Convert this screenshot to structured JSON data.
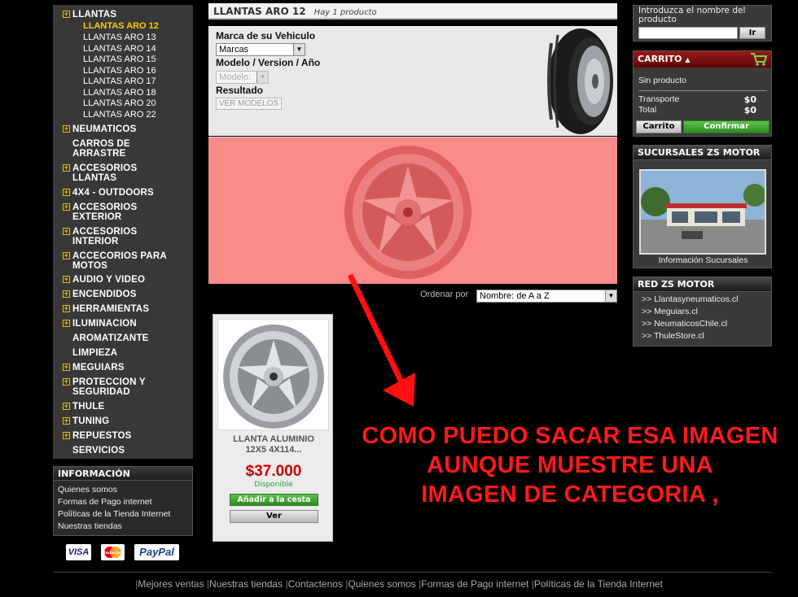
{
  "sidebar": {
    "categories": [
      {
        "label": "LLANTAS",
        "expandable": true
      },
      {
        "label": "NEUMATICOS",
        "expandable": true
      },
      {
        "label": "CARROS DE ARRASTRE",
        "expandable": false
      },
      {
        "label": "ACCESORIOS LLANTAS",
        "expandable": true
      },
      {
        "label": "4X4 - OUTDOORS",
        "expandable": true
      },
      {
        "label": "ACCESORIOS EXTERIOR",
        "expandable": true
      },
      {
        "label": "ACCESORIOS INTERIOR",
        "expandable": true
      },
      {
        "label": "ACCECORIOS PARA MOTOS",
        "expandable": true
      },
      {
        "label": "AUDIO Y VIDEO",
        "expandable": true
      },
      {
        "label": "ENCENDIDOS",
        "expandable": true
      },
      {
        "label": "HERRAMIENTAS",
        "expandable": true
      },
      {
        "label": "ILUMINACION",
        "expandable": true
      },
      {
        "label": "AROMATIZANTE",
        "expandable": false
      },
      {
        "label": "LIMPIEZA",
        "expandable": false
      },
      {
        "label": "MEGUIARS",
        "expandable": true
      },
      {
        "label": "PROTECCION Y SEGURIDAD",
        "expandable": true
      },
      {
        "label": "THULE",
        "expandable": true
      },
      {
        "label": "TUNING",
        "expandable": true
      },
      {
        "label": "REPUESTOS",
        "expandable": true
      },
      {
        "label": "SERVICIOS",
        "expandable": false
      }
    ],
    "subcategories": [
      "LLANTAS ARO 12",
      "LLANTAS ARO 13",
      "LLANTAS ARO 14",
      "LLANTAS ARO 15",
      "LLANTAS ARO 16",
      "LLANTAS ARO 17",
      "LLANTAS ARO 18",
      "LLANTAS ARO 20",
      "LLANTAS ARO 22"
    ],
    "active_sub": "LLANTAS ARO 12",
    "plus_glyph": "+"
  },
  "info": {
    "title": "INFORMACIÓN",
    "links": [
      "Quienes somos",
      "Formas de Pago internet",
      "Políticas de la Tienda Internet",
      "Nuestras tiendas"
    ]
  },
  "payment": {
    "visa": "VISA",
    "mastercard": "MasterCard",
    "paypal": "PayPal"
  },
  "center": {
    "title": "LLANTAS ARO 12",
    "count": "Hay 1 producto",
    "search": {
      "brand_label": "Marca de su Vehiculo",
      "brand_value": "Marcas",
      "model_label": "Modelo / Version / Año",
      "model_value": "Modelo:",
      "result_label": "Resultado",
      "button": "VER MODELOS"
    },
    "sort_label": "Ordenar por",
    "sort_value": "Nombre: de A a Z"
  },
  "product": {
    "name_line1": "LLANTA ALUMINIO",
    "name_line2": "12X5 4X114...",
    "price": "$37.000",
    "availability": "Disponible",
    "add_button": "Añadir a la cesta",
    "view_button": "Ver"
  },
  "annotation": {
    "line1": "COMO PUEDO SACAR ESA IMAGEN",
    "line2": "AUNQUE MUESTRE UNA",
    "line3": "IMAGEN DE CATEGORIA ,",
    "color": "#ff1a1a"
  },
  "right": {
    "search_label": "Introduzca el nombre del producto",
    "search_value": "",
    "search_button": "Ir",
    "cart": {
      "title": "CARRITO",
      "empty": "Sin producto",
      "shipping_label": "Transporte",
      "shipping_value": "$0",
      "total_label": "Total",
      "total_value": "$0",
      "cart_button": "Carrito",
      "confirm_button": "Confirmar"
    },
    "sucursales": {
      "title": "SUCURSALES ZS MOTOR",
      "caption": "Información Sucursales"
    },
    "red": {
      "title": "RED ZS MOTOR",
      "links": [
        "Llantasyneumaticos.cl",
        "Meguiars.cl",
        "NeumaticosChile.cl",
        "ThuleStore.cl"
      ],
      "bullet": ">>"
    }
  },
  "footer": {
    "links": [
      "Mejores ventas",
      "Nuestras tiendas",
      "Contactenos",
      "Quienes somos",
      "Formas de Pago internet",
      "Políticas de la Tienda Internet"
    ],
    "separator": "|"
  },
  "colors": {
    "accent_yellow": "#ffc800",
    "cart_red": "#9a1a1a",
    "price_red": "#cc0000",
    "green": "#2d8a22",
    "category_image_bg": "#fb8b88"
  }
}
